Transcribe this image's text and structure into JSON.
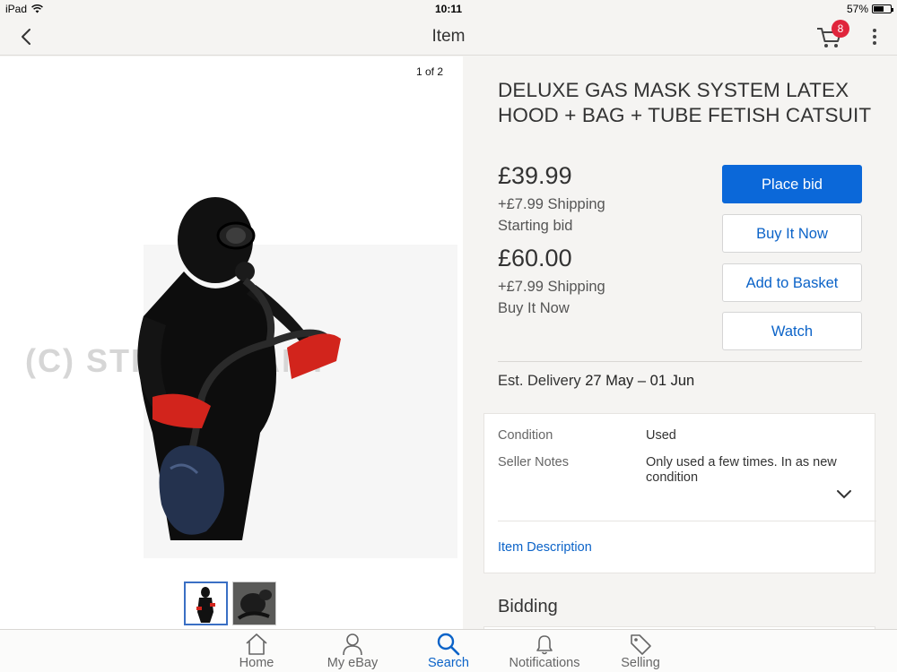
{
  "status_bar": {
    "device": "iPad",
    "time": "10:11",
    "battery": "57%",
    "battery_level": 0.57
  },
  "nav": {
    "title": "Item",
    "cart_count": "8"
  },
  "gallery": {
    "counter": "1 of 2",
    "watermark": "(C) STRASSMANY"
  },
  "item": {
    "title": "DELUXE GAS MASK SYSTEM LATEX HOOD + BAG + TUBE FETISH CATSUIT",
    "bid_price": "£39.99",
    "bid_shipping": "+£7.99 Shipping",
    "bid_label": "Starting bid",
    "bin_price": "£60.00",
    "bin_shipping": "+£7.99 Shipping",
    "bin_label": "Buy It Now"
  },
  "actions": {
    "place_bid": "Place bid",
    "buy_it_now": "Buy It Now",
    "add_to_basket": "Add to Basket",
    "watch": "Watch"
  },
  "delivery": {
    "label": "Est. Delivery",
    "dates": "27 May – 01 Jun"
  },
  "specifics": {
    "condition_label": "Condition",
    "condition_value": "Used",
    "notes_label": "Seller Notes",
    "notes_value": "Only used a few times. In as new condition",
    "description_link": "Item Description"
  },
  "bidding": {
    "title": "Bidding"
  },
  "tabs": [
    {
      "label": "Home",
      "icon": "home-icon"
    },
    {
      "label": "My eBay",
      "icon": "person-icon"
    },
    {
      "label": "Search",
      "icon": "search-icon"
    },
    {
      "label": "Notifications",
      "icon": "bell-icon"
    },
    {
      "label": "Selling",
      "icon": "tag-icon"
    }
  ],
  "colors": {
    "accent": "#0b68d9",
    "link": "#0b63c8",
    "badge": "#e0253c"
  }
}
